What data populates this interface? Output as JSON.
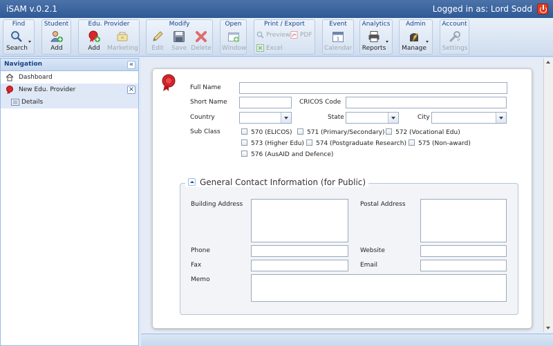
{
  "app": {
    "title": "iSAM v.0.2.1",
    "logged_in": "Logged in as: Lord Sodd"
  },
  "toolbar": {
    "find": {
      "title": "Find",
      "search": "Search"
    },
    "student": {
      "title": "Student",
      "add": "Add"
    },
    "provider": {
      "title": "Edu. Provider",
      "add": "Add",
      "marketing": "Marketing"
    },
    "modify": {
      "title": "Modify",
      "edit": "Edit",
      "save": "Save",
      "delete": "Delete"
    },
    "open": {
      "title": "Open",
      "window": "Window"
    },
    "print": {
      "title": "Print / Export",
      "preview": "Preview",
      "pdf": "PDF",
      "excel": "Excel"
    },
    "event": {
      "title": "Event",
      "calendar": "Calendar"
    },
    "analytics": {
      "title": "Analytics",
      "reports": "Reports"
    },
    "admin": {
      "title": "Admin",
      "manage": "Manage"
    },
    "account": {
      "title": "Account",
      "settings": "Settings"
    }
  },
  "nav": {
    "title": "Navigation",
    "collapse_glyph": "«",
    "close_glyph": "×",
    "items": [
      {
        "label": "Dashboard"
      },
      {
        "label": "New Edu. Provider"
      },
      {
        "label": "Details"
      }
    ]
  },
  "form": {
    "full_name": {
      "label": "Full Name",
      "value": ""
    },
    "short_name": {
      "label": "Short Name",
      "value": ""
    },
    "cricos_code": {
      "label": "CRICOS Code",
      "value": ""
    },
    "country": {
      "label": "Country",
      "value": ""
    },
    "state": {
      "label": "State",
      "value": ""
    },
    "city": {
      "label": "City",
      "value": ""
    },
    "sub_class": {
      "label": "Sub Class",
      "options": [
        "570 (ELICOS)",
        "571 (Primary/Secondary)",
        "572 (Vocational Edu)",
        "573 (Higher Edu)",
        "574 (Postgraduate Research)",
        "575 (Non-award)",
        "576 (AusAID and Defence)"
      ]
    }
  },
  "contact": {
    "legend": "General Contact Information (for Public)",
    "building_address": "Building Address",
    "postal_address": "Postal Address",
    "phone": "Phone",
    "website": "Website",
    "fax": "Fax",
    "email": "Email",
    "memo": "Memo"
  },
  "colors": {
    "title_bar": "#2f5a96",
    "accent": "#15428b",
    "background": "#dfe8f6"
  }
}
